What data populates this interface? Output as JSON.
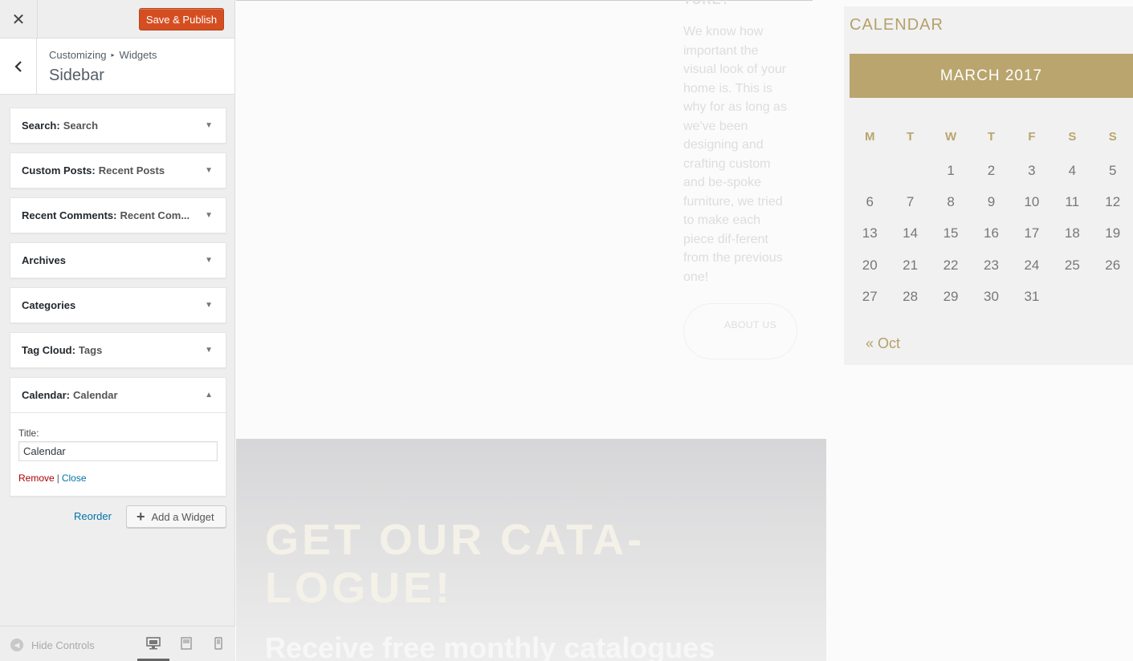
{
  "customizer": {
    "close_glyph": "✕",
    "publish_label": "Save & Publish",
    "breadcrumb": [
      "Customizing",
      "Widgets"
    ],
    "section_title": "Sidebar",
    "widgets": [
      {
        "name": "Search:",
        "title": "Search",
        "expanded": false
      },
      {
        "name": "Custom Posts:",
        "title": "Recent Posts",
        "expanded": false
      },
      {
        "name": "Recent Comments:",
        "title": "Recent Com...",
        "expanded": false
      },
      {
        "name": "Archives",
        "title": "",
        "expanded": false
      },
      {
        "name": "Categories",
        "title": "",
        "expanded": false
      },
      {
        "name": "Tag Cloud:",
        "title": "Tags",
        "expanded": false
      },
      {
        "name": "Calendar:",
        "title": "Calendar",
        "expanded": true
      }
    ],
    "calendar_form": {
      "title_label": "Title:",
      "title_value": "Calendar",
      "remove_label": "Remove",
      "separator": "|",
      "close_label": "Close"
    },
    "reorder_label": "Reorder",
    "add_widget_label": "Add a Widget",
    "hide_controls_label": "Hide Controls"
  },
  "preview": {
    "about_heading": "TURE?",
    "about_text": "We know how important the visual look of your home is. This is why for as long as we've been designing and crafting custom and be-spoke furniture, we tried to make each piece dif-ferent from the previous one!",
    "about_button": "ABOUT US",
    "catalogue_title": "GET OUR CATA-LOGUE!",
    "catalogue_sub": "Receive free monthly catalogues",
    "calendar": {
      "heading": "CALENDAR",
      "month": "MARCH 2017",
      "weekdays": [
        "M",
        "T",
        "W",
        "T",
        "F",
        "S",
        "S"
      ],
      "weeks": [
        [
          "",
          "",
          "1",
          "2",
          "3",
          "4",
          "5"
        ],
        [
          "6",
          "7",
          "8",
          "9",
          "10",
          "11",
          "12"
        ],
        [
          "13",
          "14",
          "15",
          "16",
          "17",
          "18",
          "19"
        ],
        [
          "20",
          "21",
          "22",
          "23",
          "24",
          "25",
          "26"
        ],
        [
          "27",
          "28",
          "29",
          "30",
          "31",
          "",
          ""
        ]
      ],
      "prev_link": "« Oct"
    }
  },
  "colors": {
    "publish": "#d54e21",
    "gold": "#b9a56d",
    "link": "#0073aa",
    "remove": "#aa0000"
  }
}
